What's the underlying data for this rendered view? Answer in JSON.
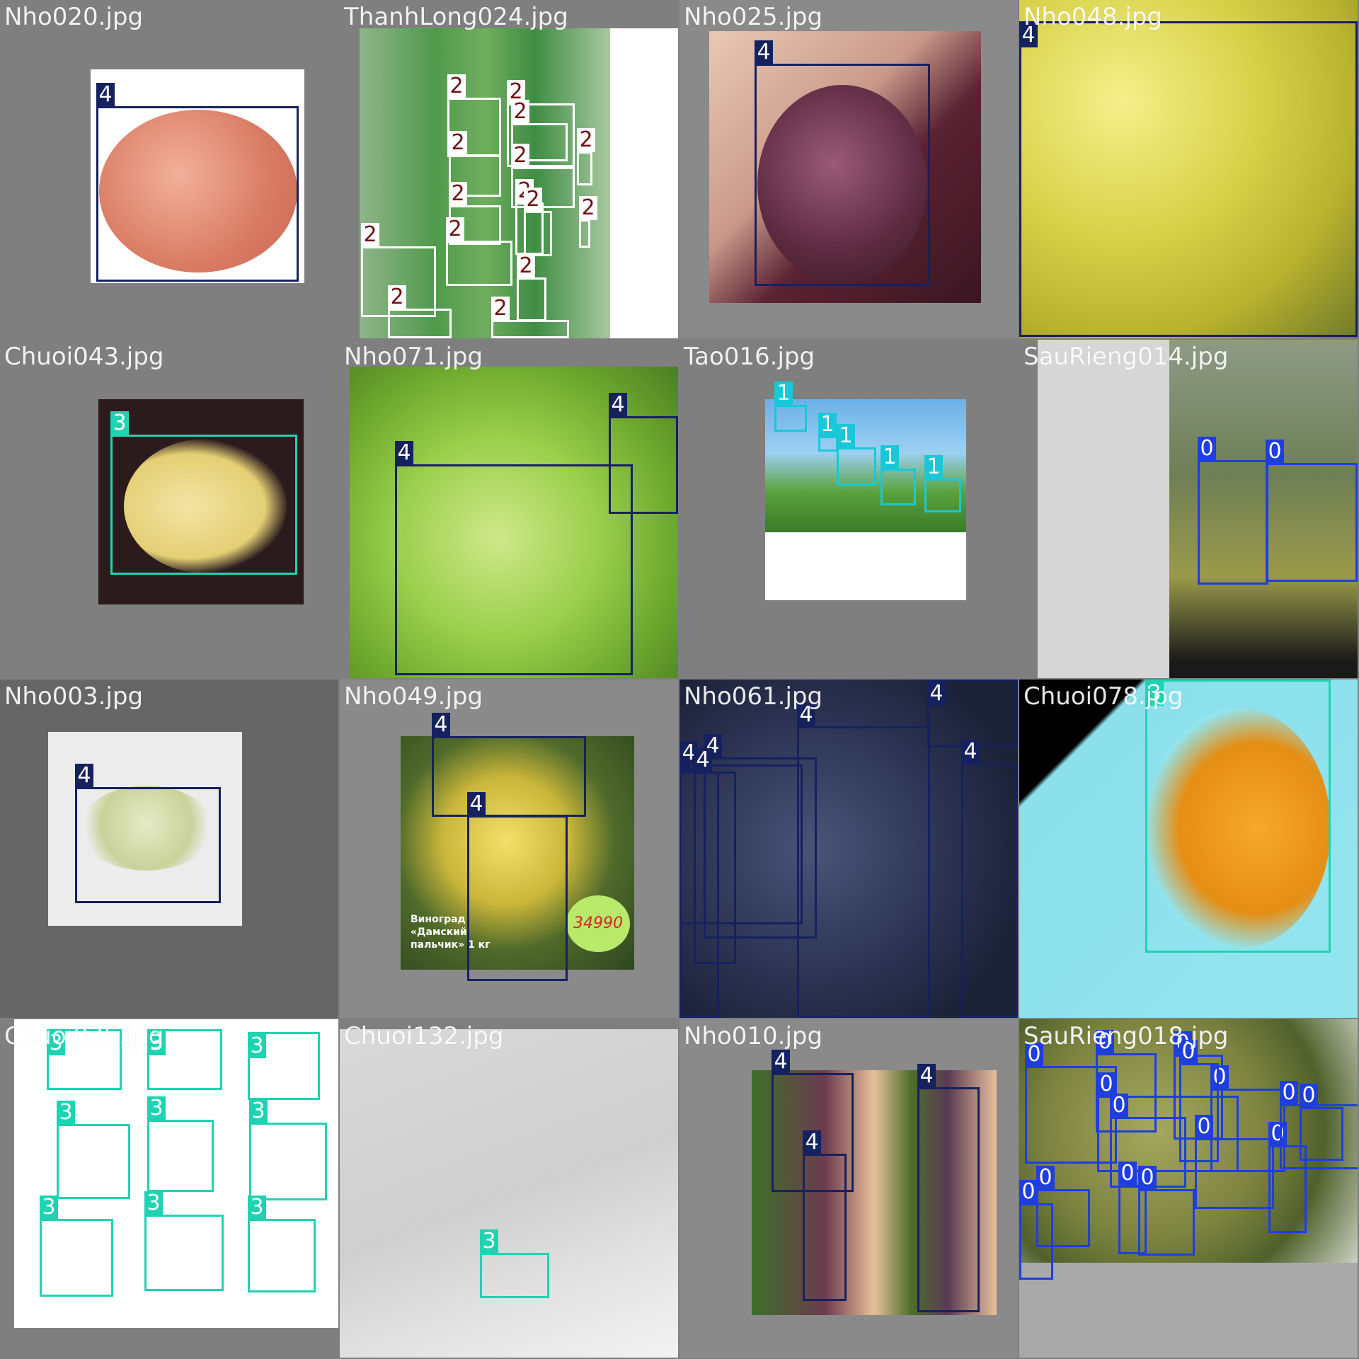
{
  "colors": {
    "0": "#1f3ee0",
    "1": "#19c8d8",
    "2": "#ffffff",
    "3": "#1ed3b2",
    "4": "#16215f",
    "label_text": "#ffffff",
    "label_text_class2": "#6e1212"
  },
  "tiles": [
    {
      "filename": "Nho020.jpg",
      "boxes": [
        {
          "cls": "4"
        }
      ]
    },
    {
      "filename": "ThanhLong024.jpg",
      "boxes": [
        {
          "cls": "2"
        },
        {
          "cls": "2"
        },
        {
          "cls": "2"
        },
        {
          "cls": "2"
        },
        {
          "cls": "2"
        },
        {
          "cls": "2"
        },
        {
          "cls": "2"
        },
        {
          "cls": "2"
        },
        {
          "cls": "2"
        },
        {
          "cls": "2"
        },
        {
          "cls": "2"
        },
        {
          "cls": "2"
        },
        {
          "cls": "2"
        },
        {
          "cls": "2"
        },
        {
          "cls": "2"
        }
      ]
    },
    {
      "filename": "Nho025.jpg",
      "boxes": [
        {
          "cls": "4"
        }
      ]
    },
    {
      "filename": "Nho048.jpg",
      "boxes": [
        {
          "cls": "4"
        }
      ]
    },
    {
      "filename": "Chuoi043.jpg",
      "boxes": [
        {
          "cls": "3"
        }
      ]
    },
    {
      "filename": "Nho071.jpg",
      "boxes": [
        {
          "cls": "4"
        },
        {
          "cls": "4"
        }
      ]
    },
    {
      "filename": "Tao016.jpg",
      "boxes": [
        {
          "cls": "1"
        },
        {
          "cls": "1"
        },
        {
          "cls": "1"
        },
        {
          "cls": "1"
        },
        {
          "cls": "1"
        }
      ]
    },
    {
      "filename": "SauRieng014.jpg",
      "boxes": [
        {
          "cls": "0"
        },
        {
          "cls": "0"
        }
      ]
    },
    {
      "filename": "Nho003.jpg",
      "boxes": [
        {
          "cls": "4"
        }
      ]
    },
    {
      "filename": "Nho049.jpg",
      "boxes": [
        {
          "cls": "4"
        },
        {
          "cls": "4"
        }
      ]
    },
    {
      "filename": "Nho061.jpg",
      "boxes": [
        {
          "cls": "4"
        },
        {
          "cls": "4"
        },
        {
          "cls": "4"
        },
        {
          "cls": "4"
        },
        {
          "cls": "4"
        },
        {
          "cls": "4"
        },
        {
          "cls": "4"
        }
      ]
    },
    {
      "filename": "Chuoi078.jpg",
      "boxes": [
        {
          "cls": "3"
        }
      ]
    },
    {
      "filename": "Chuoi035.jpg",
      "boxes": [
        {
          "cls": "3"
        },
        {
          "cls": "3"
        },
        {
          "cls": "3"
        },
        {
          "cls": "3"
        },
        {
          "cls": "3"
        },
        {
          "cls": "3"
        },
        {
          "cls": "3"
        },
        {
          "cls": "3"
        },
        {
          "cls": "3"
        }
      ]
    },
    {
      "filename": "Chuoi132.jpg",
      "boxes": [
        {
          "cls": "3"
        }
      ]
    },
    {
      "filename": "Nho010.jpg",
      "boxes": [
        {
          "cls": "4"
        },
        {
          "cls": "4"
        },
        {
          "cls": "4"
        }
      ]
    },
    {
      "filename": "SauRieng018.jpg",
      "boxes": [
        {
          "cls": "0"
        },
        {
          "cls": "0"
        },
        {
          "cls": "0"
        },
        {
          "cls": "0"
        },
        {
          "cls": "0"
        },
        {
          "cls": "0"
        },
        {
          "cls": "0"
        },
        {
          "cls": "0"
        },
        {
          "cls": "0"
        },
        {
          "cls": "0"
        },
        {
          "cls": "0"
        },
        {
          "cls": "0"
        },
        {
          "cls": "0"
        },
        {
          "cls": "0"
        },
        {
          "cls": "0"
        }
      ]
    }
  ],
  "embedded_text": {
    "nho049_sign": "Виноград «Дамский пальчик» 1 кг",
    "nho049_price": "34990"
  }
}
